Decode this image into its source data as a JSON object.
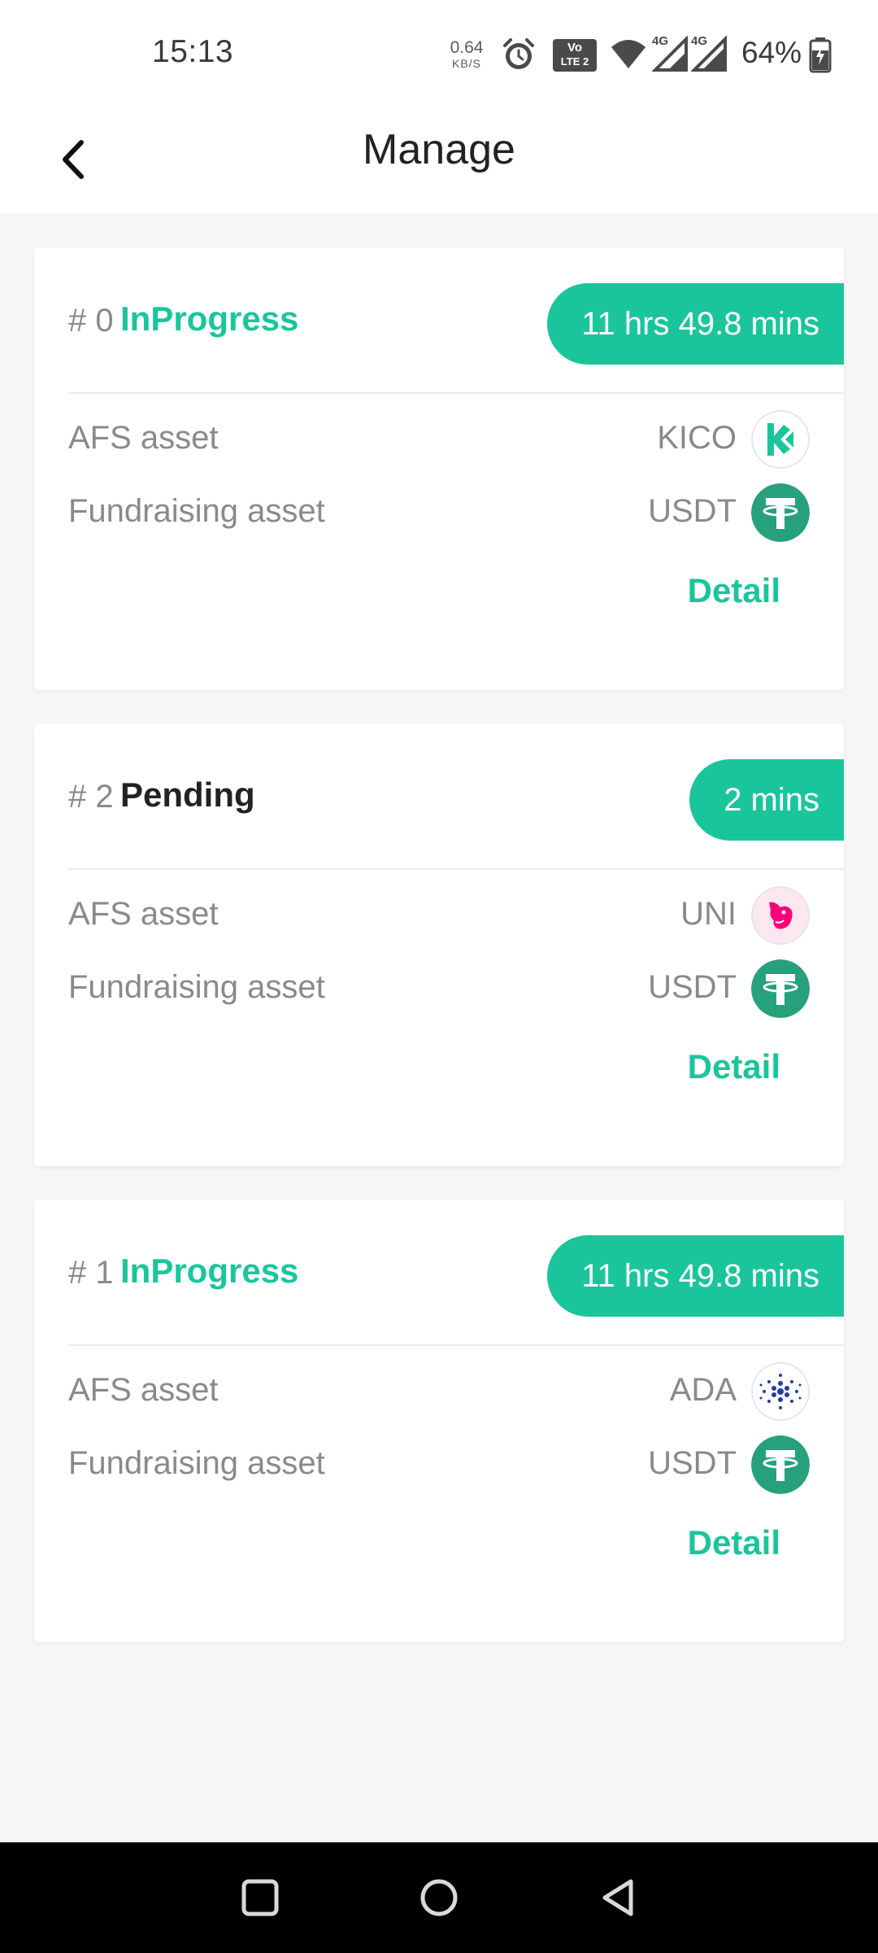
{
  "status_bar": {
    "time": "15:13",
    "net_speed_value": "0.64",
    "net_speed_unit": "KB/S",
    "volte_top": "Vo",
    "volte_bottom": "LTE 2",
    "signal_1_label": "4G",
    "signal_2_label": "4G",
    "battery_percent": "64%"
  },
  "header": {
    "title": "Manage"
  },
  "cards": [
    {
      "number": "# 0",
      "status": "InProgress",
      "status_color": "#1bc59b",
      "timer": "11 hrs 49.8 mins",
      "afs_label": "AFS asset",
      "afs_value": "KICO",
      "afs_icon": "kico-coin-icon",
      "fund_label": "Fundraising asset",
      "fund_value": "USDT",
      "fund_icon": "usdt-coin-icon",
      "detail_label": "Detail"
    },
    {
      "number": "# 2",
      "status": "Pending",
      "status_color": "#222222",
      "timer": "2 mins",
      "afs_label": "AFS asset",
      "afs_value": "UNI",
      "afs_icon": "uni-coin-icon",
      "fund_label": "Fundraising asset",
      "fund_value": "USDT",
      "fund_icon": "usdt-coin-icon",
      "detail_label": "Detail"
    },
    {
      "number": "# 1",
      "status": "InProgress",
      "status_color": "#1bc59b",
      "timer": "11 hrs 49.8 mins",
      "afs_label": "AFS asset",
      "afs_value": "ADA",
      "afs_icon": "ada-coin-icon",
      "fund_label": "Fundraising asset",
      "fund_value": "USDT",
      "fund_icon": "usdt-coin-icon",
      "detail_label": "Detail"
    }
  ],
  "colors": {
    "accent": "#1bc59b",
    "background": "#f6f6f6",
    "muted_text": "#8a8a8a"
  }
}
